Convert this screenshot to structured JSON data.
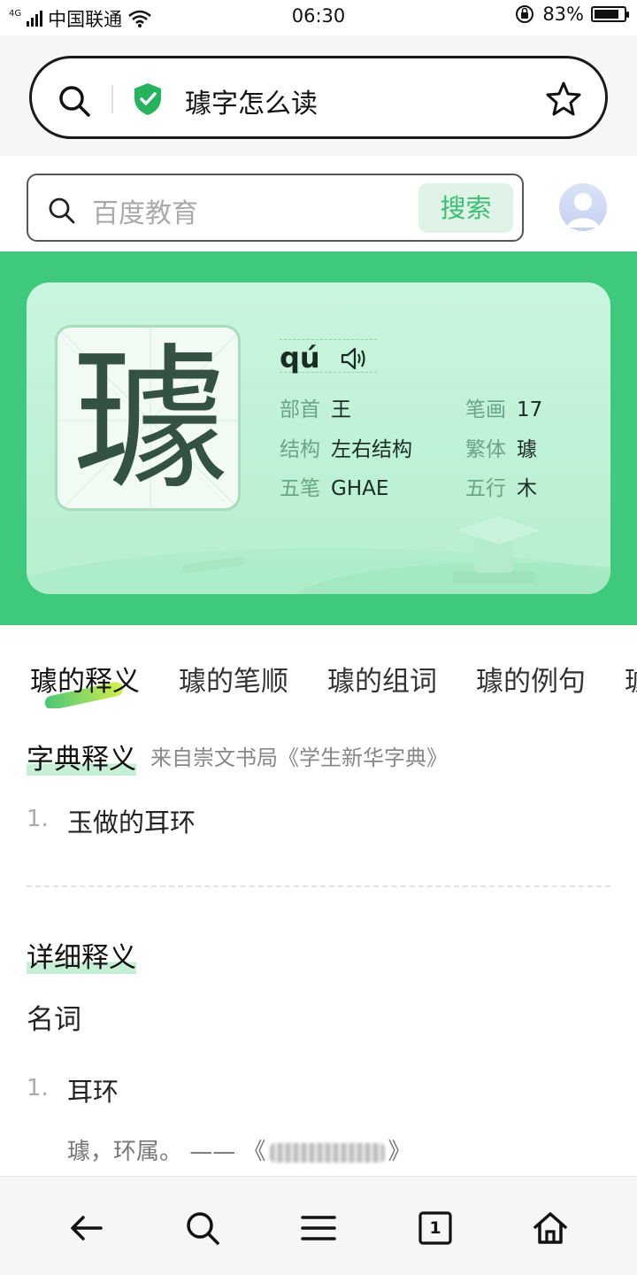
{
  "status_bar": {
    "network": "4G",
    "carrier": "中国联通",
    "time": "06:30",
    "battery_percent": "83%",
    "battery_level": 0.83
  },
  "browser": {
    "url_text": "璩字怎么读"
  },
  "search": {
    "placeholder": "百度教育",
    "button_label": "搜索"
  },
  "character": {
    "glyph": "璩",
    "pinyin": "qú",
    "info": [
      {
        "label": "部首",
        "value": "王"
      },
      {
        "label": "笔画",
        "value": "17"
      },
      {
        "label": "结构",
        "value": "左右结构"
      },
      {
        "label": "繁体",
        "value": "璩"
      },
      {
        "label": "五笔",
        "value": "GHAE"
      },
      {
        "label": "五行",
        "value": "木"
      }
    ]
  },
  "tabs": [
    "璩的释义",
    "璩的笔顺",
    "璩的组词",
    "璩的例句",
    "璩"
  ],
  "active_tab": 0,
  "dictionary": {
    "title": "字典释义",
    "source": "来自崇文书局《学生新华字典》",
    "items": [
      {
        "num": "1.",
        "text": "玉做的耳环"
      }
    ]
  },
  "detail": {
    "title": "详细释义",
    "part_of_speech": "名词",
    "items": [
      {
        "num": "1.",
        "text": "耳环"
      }
    ],
    "example_text": "璩，环属。 ——",
    "example_open": "《",
    "example_close": "》"
  },
  "colors": {
    "brand_green": "#3ec97d",
    "card_green": "#c9f5de",
    "button_text": "#3bbf74"
  },
  "icons": [
    "search-icon",
    "shield-check-icon",
    "star-icon",
    "speaker-icon",
    "back-arrow-icon",
    "menu-icon",
    "tabs-count-icon",
    "home-icon"
  ],
  "bottom_nav": {
    "tab_count": "1"
  }
}
